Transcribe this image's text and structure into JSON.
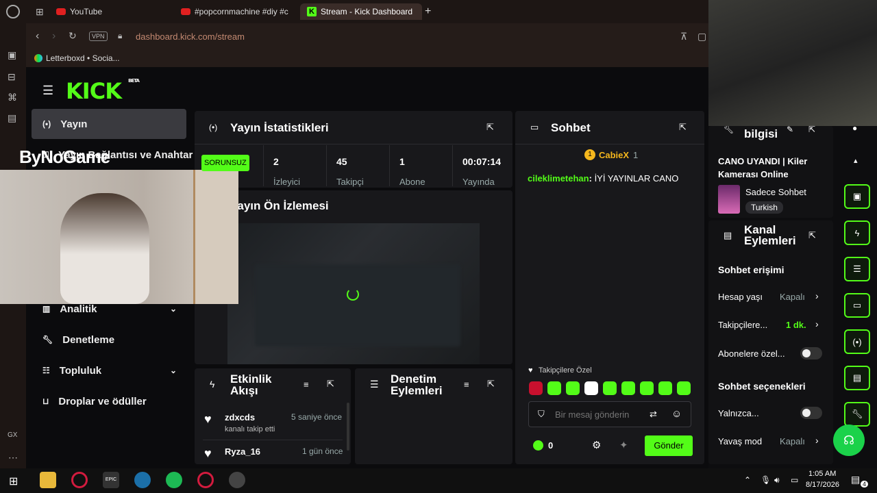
{
  "browser": {
    "tabs": [
      {
        "label": "YouTube"
      },
      {
        "label": "#popcornmachine #diy #c"
      },
      {
        "label": "Stream - Kick Dashboard"
      }
    ],
    "new_tab_label": "+",
    "url": "dashboard.kick.com/stream",
    "vpn_label": "VPN",
    "bookmark": "Letterboxd • Socia..."
  },
  "overlay": {
    "streamer_brand": "ByNoGame"
  },
  "kick": {
    "logo": "KICK",
    "logo_beta": "BETA",
    "sidebar": {
      "items": [
        {
          "label": "Yayın",
          "icon": "broadcast-icon"
        },
        {
          "label": "Yayın Bağlantısı ve Anahtarı",
          "icon": "key-icon"
        },
        {
          "label": "Analitik",
          "icon": "chart-icon"
        },
        {
          "label": "Denetleme",
          "icon": "wrench-icon"
        },
        {
          "label": "Topluluk",
          "icon": "community-icon"
        },
        {
          "label": "Droplar ve ödüller",
          "icon": "drops-icon"
        }
      ]
    },
    "stats": {
      "title": "Yayın İstatistikleri",
      "status_badge": "SORUNSUZ",
      "items": [
        {
          "value": "2",
          "label": "İzleyici"
        },
        {
          "value": "45",
          "label": "Takipçi"
        },
        {
          "value": "1",
          "label": "Abone"
        },
        {
          "value": "00:07:14",
          "label": "Yayında"
        }
      ]
    },
    "preview": {
      "title": "Yayın Ön İzlemesi"
    },
    "activity": {
      "title_line1": "Etkinlik",
      "title_line2": "Akışı",
      "events": [
        {
          "user": "zdxcds",
          "time": "5 saniye önce",
          "desc": "kanalı takip etti"
        },
        {
          "user": "Ryza_16",
          "time": "1 gün önce",
          "desc": ""
        }
      ]
    },
    "mod_actions": {
      "title_line1": "Denetim",
      "title_line2": "Eylemleri"
    },
    "chat": {
      "title": "Sohbet",
      "pinned_user": "CabieX",
      "pinned_count": "1",
      "messages": [
        {
          "user": "cileklimetehan",
          "text": "İYİ YAYINLAR CANO"
        }
      ],
      "followers_only": "Takipçilere Özel",
      "placeholder": "Bir mesaj gönderin",
      "count": "0",
      "send": "Gönder"
    },
    "stream_info": {
      "title": "bilgisi",
      "stream_title": "CANO UYANDI | Kiler Kamerası Online",
      "category": "Sadece Sohbet",
      "language": "Turkish"
    },
    "channel_actions": {
      "title_line1": "Kanal",
      "title_line2": "Eylemleri",
      "chat_access": "Sohbet erişimi",
      "rows": [
        {
          "label": "Hesap yaşı",
          "value": "Kapalı"
        },
        {
          "label": "Takipçilere...",
          "value": "1 dk."
        },
        {
          "label": "Abonelere özel...",
          "value": ""
        }
      ],
      "chat_options": "Sohbet seçenekleri",
      "rows2": [
        {
          "label": "Yalnızca...",
          "value": ""
        },
        {
          "label": "Yavaş mod",
          "value": "Kapalı"
        }
      ]
    }
  },
  "taskbar": {
    "time": "1:05 AM",
    "date": "8/17/2026",
    "notifications": "4"
  },
  "colors": {
    "accent": "#53fc18",
    "panel": "#18181b",
    "page": "#0b0b0d"
  }
}
